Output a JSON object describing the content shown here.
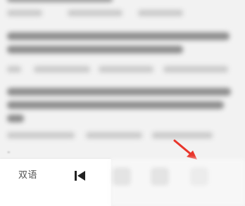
{
  "toolbar": {
    "bilingual_label": "双语"
  },
  "icons": {
    "previous": "skip-previous-icon",
    "pointer": "red-arrow-icon"
  },
  "colors": {
    "arrow": "#e8352b",
    "icon": "#222222"
  }
}
